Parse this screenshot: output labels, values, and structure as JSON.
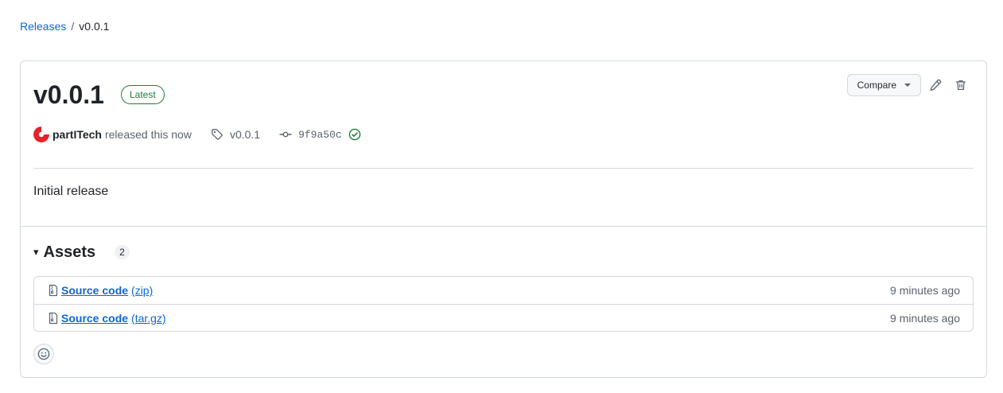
{
  "breadcrumb": {
    "releases_label": "Releases",
    "separator": "/",
    "current": "v0.0.1"
  },
  "release": {
    "title": "v0.0.1",
    "badge": "Latest",
    "author": "partITech",
    "released_text": "released this now",
    "tag": "v0.0.1",
    "commit": "9f9a50c",
    "body": "Initial release"
  },
  "actions": {
    "compare_label": "Compare"
  },
  "assets": {
    "title": "Assets",
    "count": "2",
    "items": [
      {
        "name": "Source code",
        "ext": "(zip)",
        "time": "9 minutes ago"
      },
      {
        "name": "Source code",
        "ext": "(tar.gz)",
        "time": "9 minutes ago"
      }
    ]
  },
  "colors": {
    "link": "#0969da",
    "success": "#1a7f37",
    "border": "#d1d9e0",
    "muted": "#59636e"
  },
  "icons": [
    "tag-icon",
    "commit-icon",
    "check-circle-icon",
    "pencil-icon",
    "trash-icon",
    "file-zip-icon",
    "smiley-icon",
    "triangle-down-icon"
  ]
}
